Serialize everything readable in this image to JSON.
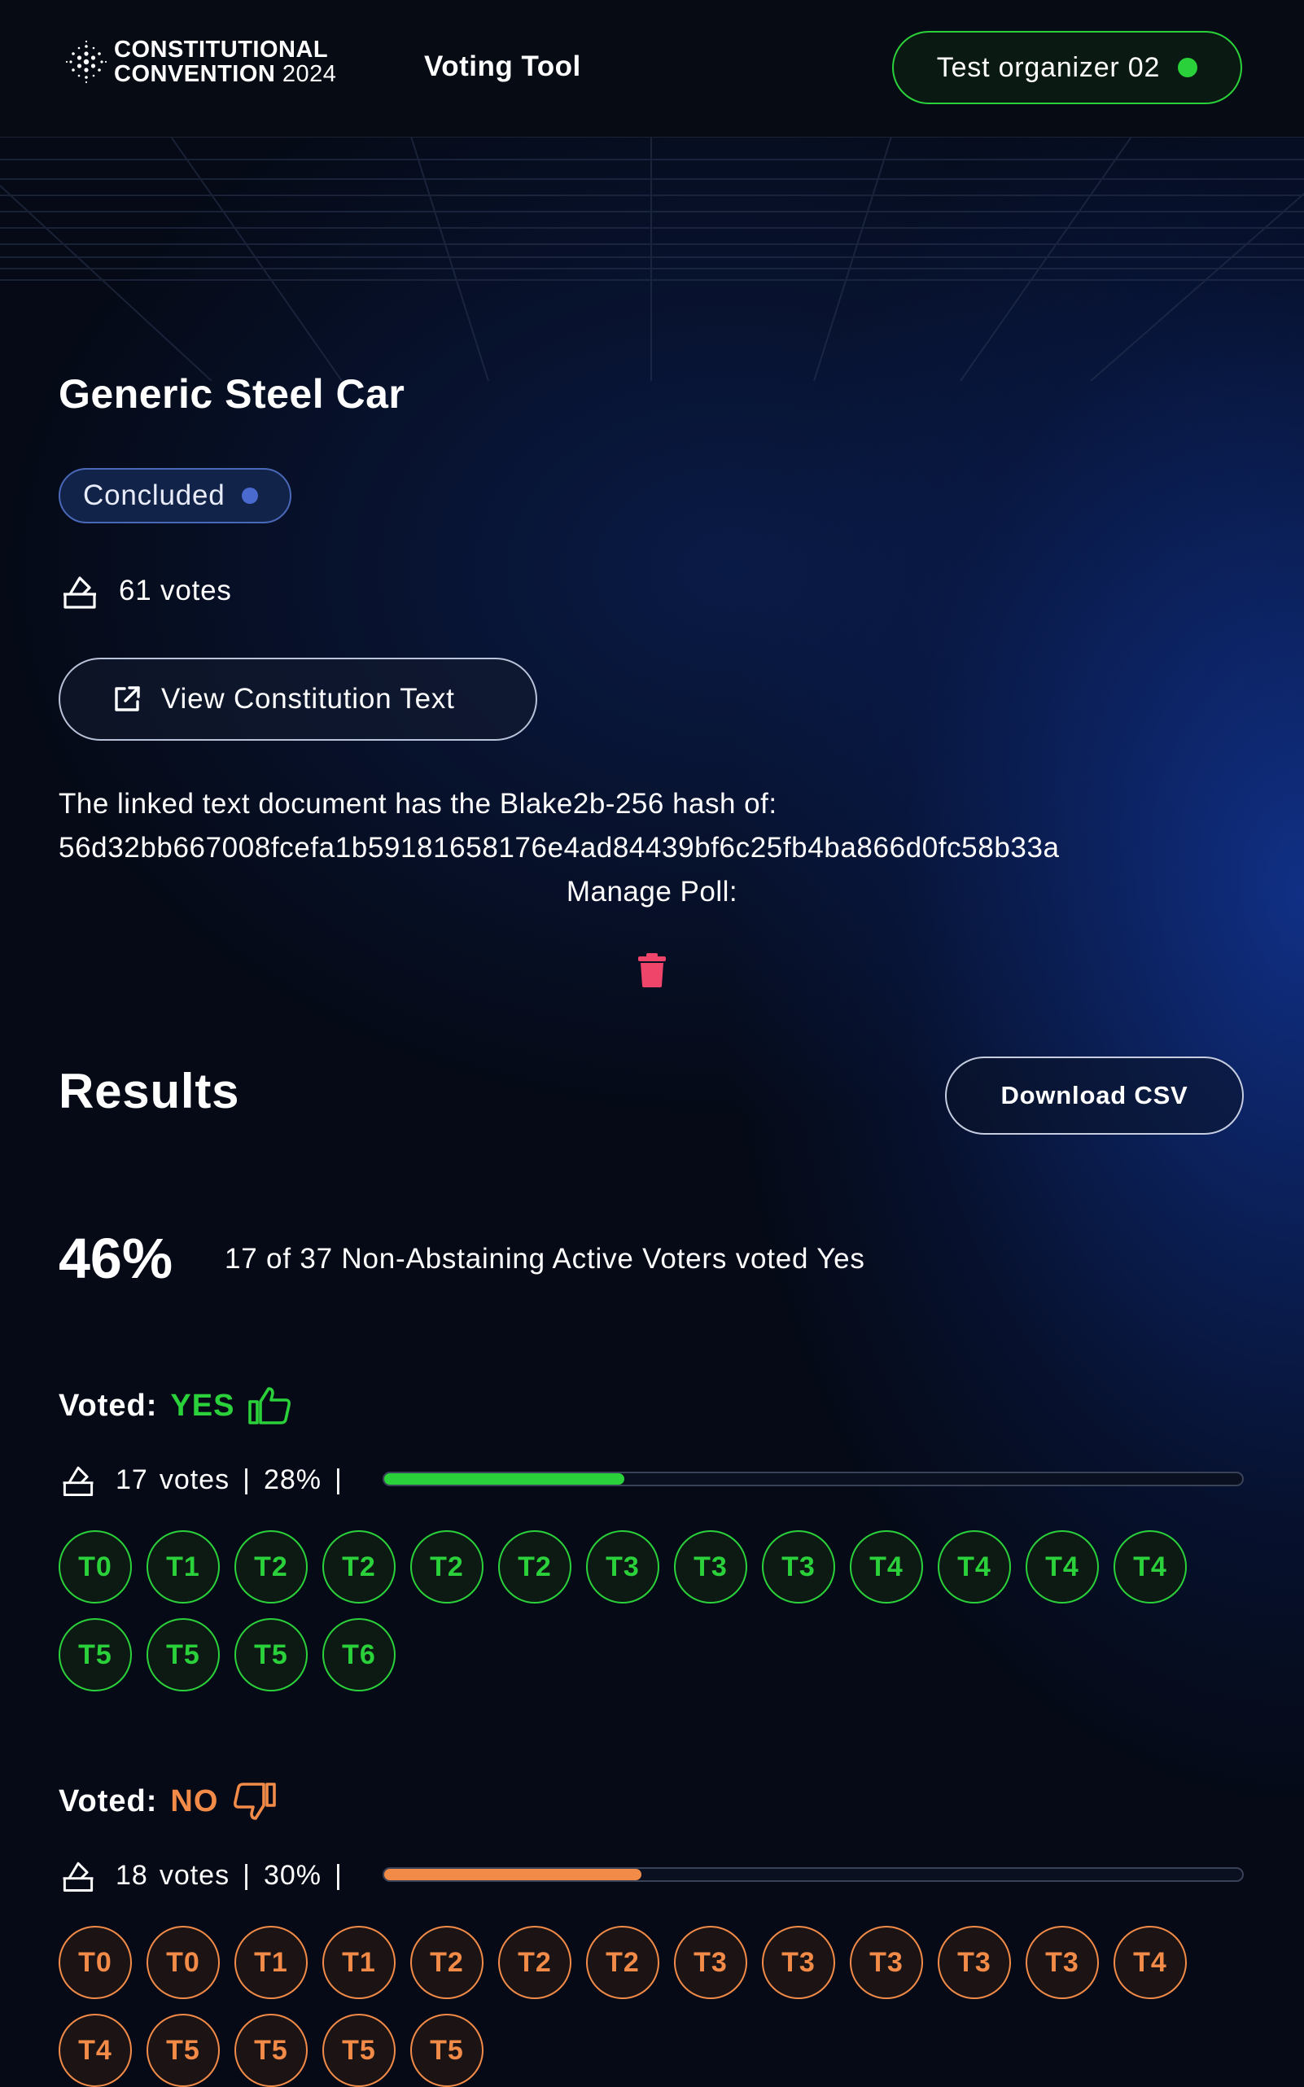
{
  "header": {
    "logo_line1": "CONSTITUTIONAL",
    "logo_line2": "CONVENTION",
    "logo_year": "2024",
    "app_name": "Voting Tool",
    "user_name": "Test organizer 02",
    "online_color": "#2bd13a"
  },
  "poll": {
    "title": "Generic Steel Car",
    "status": "Concluded",
    "votes": "61 votes",
    "view_button": "View Constitution Text",
    "hash_intro": "The linked text document has the Blake2b-256 hash of:",
    "hash": "56d32bb667008fcefa1b59181658176e4ad84439bf6c25fb4ba866d0fc58b33a",
    "manage_label": "Manage Poll:",
    "delete_icon": "trash-icon"
  },
  "results": {
    "heading": "Results",
    "download_label": "Download CSV",
    "percent": "46%",
    "summary": "17 of 37 Non-Abstaining Active Voters voted Yes",
    "yes": {
      "label": "Voted:",
      "value": "YES",
      "icon": "thumbs-up-icon",
      "count": "17",
      "count_word": "votes",
      "percent_text": "28%",
      "fraction": 0.28,
      "color": "#2bd13a",
      "delegates": [
        "T0",
        "T1",
        "T2",
        "T2",
        "T2",
        "T2",
        "T3",
        "T3",
        "T3",
        "T4",
        "T4",
        "T4",
        "T4",
        "T5",
        "T5",
        "T5",
        "T6"
      ]
    },
    "no": {
      "label": "Voted:",
      "value": "NO",
      "icon": "thumbs-down-icon",
      "count": "18",
      "count_word": "votes",
      "percent_text": "30%",
      "fraction": 0.3,
      "color": "#f28a48",
      "delegates": [
        "T0",
        "T0",
        "T1",
        "T1",
        "T2",
        "T2",
        "T2",
        "T3",
        "T3",
        "T3",
        "T3",
        "T3",
        "T4",
        "T4",
        "T5",
        "T5",
        "T5",
        "T5"
      ]
    }
  }
}
